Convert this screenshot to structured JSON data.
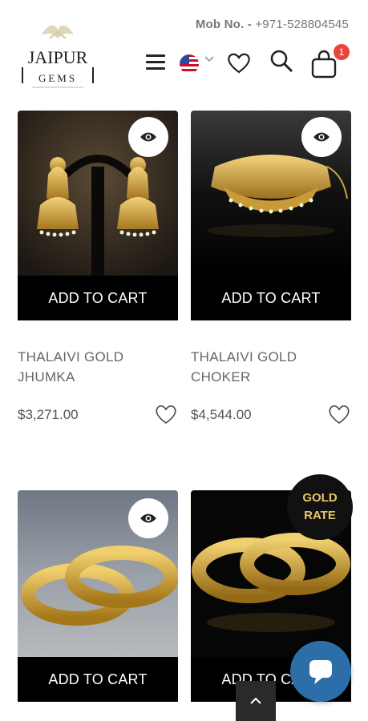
{
  "header": {
    "phone_label": "Mob No. -",
    "phone_number": "+971-528804545",
    "logo_text": "JAIPUR",
    "logo_subtext": "GEMS",
    "cart_count": "1",
    "icons": [
      "menu-icon",
      "us-flag-icon",
      "chevron-down-icon",
      "heart-icon",
      "search-icon",
      "shopping-bag-icon"
    ]
  },
  "products": [
    {
      "name": "THALAIVI GOLD JHUMKA",
      "price": "$3,271.00",
      "cart_label": "ADD TO CART"
    },
    {
      "name": "THALAIVI GOLD CHOKER",
      "price": "$4,544.00",
      "cart_label": "ADD TO CART"
    },
    {
      "name": "",
      "price": "",
      "cart_label": "ADD TO CART"
    },
    {
      "name": "",
      "price": "",
      "cart_label": "ADD TO CART"
    }
  ],
  "gold_rate": {
    "line1": "GOLD",
    "line2": "RATE"
  },
  "colors": {
    "accent": "#000000",
    "badge": "#e8453c",
    "gold": "#e8c46a",
    "chat": "#2c6fa8"
  }
}
